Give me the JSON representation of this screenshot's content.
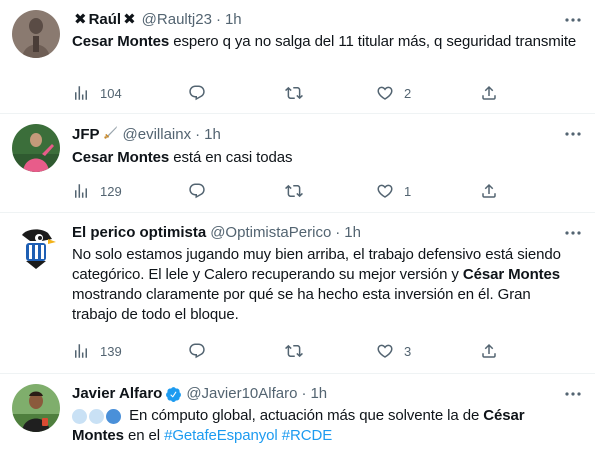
{
  "tweets": [
    {
      "display_name": "Raúl",
      "name_emoji": "✖",
      "handle": "@Raultj23",
      "time": "1h",
      "body_bold": "Cesar Montes",
      "body_text": " espero q ya no salga del 11 titular más, q seguridad transmite",
      "stats": {
        "views": "104",
        "replies": "",
        "retweets": "",
        "likes": "2",
        "share": ""
      }
    },
    {
      "display_name": "JFP",
      "handle": "@evillainx",
      "time": "1h",
      "body_bold": "Cesar Montes",
      "body_text": " está en casi todas",
      "stats": {
        "views": "129",
        "replies": "",
        "retweets": "",
        "likes": "1",
        "share": ""
      }
    },
    {
      "display_name": "El perico optimista",
      "handle": "@OptimistaPerico",
      "time": "1h",
      "body_pre": "No solo estamos jugando muy bien arriba, el trabajo defensivo está siendo categórico. El lele y Calero recuperando su mejor versión y ",
      "body_bold": "César Montes",
      "body_post": " mostrando claramente por qué se ha hecho esta inversión en él. Gran trabajo de todo el bloque.",
      "stats": {
        "views": "139",
        "replies": "",
        "retweets": "",
        "likes": "3",
        "share": ""
      }
    },
    {
      "display_name": "Javier Alfaro",
      "handle": "@Javier10Alfaro",
      "time": "1h",
      "body_pre": " En cómputo global, actuación más que solvente la de ",
      "body_bold_1": "César",
      "body_bold_2": "Montes",
      "body_mid": " en el ",
      "hashtag_1": "#GetafeEspanyol",
      "hashtag_2": "#RCDE"
    }
  ],
  "colors": {
    "text": "#0f1419",
    "muted": "#536471",
    "link": "#1d9bf0",
    "divider": "#eff3f4"
  }
}
